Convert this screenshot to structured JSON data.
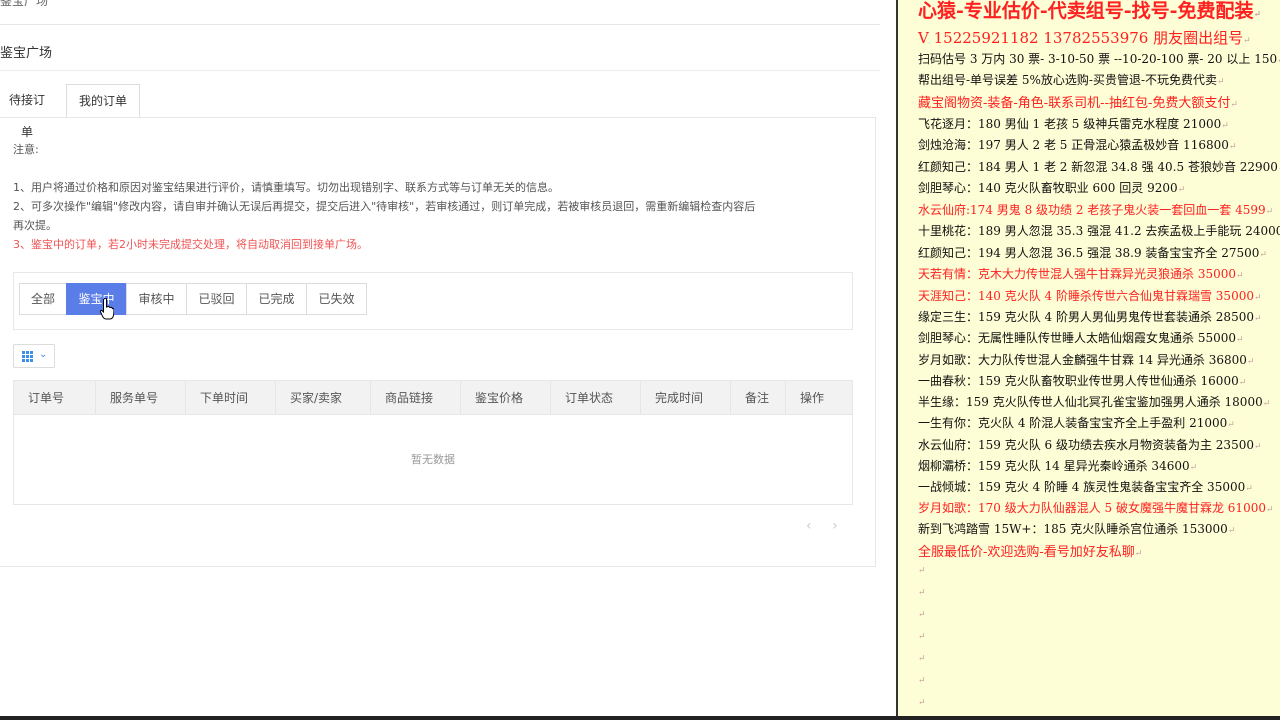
{
  "topbar": {
    "crumb": "鉴宝广场",
    "email": "",
    "logout": ""
  },
  "page_title": "鉴宝广场",
  "tabs": [
    {
      "label": "待接订单"
    },
    {
      "label": "我的订单"
    }
  ],
  "notice": {
    "heading": "注意:",
    "item1": "1、用户将通过价格和原因对鉴宝结果进行评价，请慎重填写。切勿出现错别字、联系方式等与订单无关的信息。",
    "item2a": "2、可多次操作\"编辑\"修改内容，请自审并确认无误后再提交，提交后进入\"待审核\"，若审核通过，则订单完成，若被审核员退回，需重新编辑检查内容后",
    "item2b": "再次提。",
    "item3": "3、鉴宝中的订单，若2小时未完成提交处理，将自动取消回到接单广场。"
  },
  "filters": [
    {
      "label": "全部",
      "active": false
    },
    {
      "label": "鉴宝中",
      "active": true
    },
    {
      "label": "审核中",
      "active": false
    },
    {
      "label": "已驳回",
      "active": false
    },
    {
      "label": "已完成",
      "active": false
    },
    {
      "label": "已失效",
      "active": false
    }
  ],
  "table": {
    "columns": [
      "订单号",
      "服务单号",
      "下单时间",
      "买家/卖家",
      "商品链接",
      "鉴宝价格",
      "订单状态",
      "完成时间",
      "备注",
      "操作"
    ],
    "empty_text": "暂无数据"
  },
  "icons": {
    "grid": "grid-icon",
    "chevron": "chevron-down-icon",
    "prev": "chevron-left-icon",
    "next": "chevron-right-icon",
    "cursor": "hand-cursor-icon"
  },
  "ad_lines": [
    {
      "text": "心猿-专业估价-代卖组号-找号-免费配装",
      "color": "#ff2020"
    },
    {
      "text": "V 15225921182   13782553976 朋友圈出组号",
      "color": "#ff2020"
    },
    {
      "text": "扫码估号 3 万内 30 票- 3-10-50 票  --10-20-100 票- 20 以上 150",
      "color": "#111111"
    },
    {
      "text": "帮出组号-单号误差 5%放心选购-买贵管退-不玩免费代卖",
      "color": "#111111"
    },
    {
      "text": "藏宝阁物资-装备-角色-联系司机--抽红包-免费大额支付",
      "color": "#ff2020"
    },
    {
      "text": "飞花逐月：180 男仙 1 老孩 5 级神兵雷克水程度 21000",
      "color": "#111111"
    },
    {
      "text": "剑烛沧海：197 男人 2 老 5 正骨混心猿孟极妙音 116800",
      "color": "#111111"
    },
    {
      "text": "红颜知己：184 男人 1 老 2 新忽混 34.8 强 40.5 苍狼妙音 22900",
      "color": "#111111"
    },
    {
      "text": "剑胆琴心：140 克火队畜牧职业 600 回灵 9200",
      "color": "#111111"
    },
    {
      "text": "水云仙府:174 男鬼 8 级功绩 2 老孩子鬼火装一套回血一套 4599",
      "color": "#ff2020"
    },
    {
      "text": "十里桃花：189 男人忽混 35.3 强混 41.2 去疾孟极上手能玩 24000",
      "color": "#111111"
    },
    {
      "text": "红颜知己：194 男人忽混 36.5 强混 38.9 装备宝宝齐全 27500",
      "color": "#111111"
    },
    {
      "text": "天若有情：克木大力传世混人强牛甘霖异光灵狼通杀 35000",
      "color": "#ff2020"
    },
    {
      "text": "天涯知己：140 克火队 4 阶睡杀传世六合仙鬼甘霖瑞雪 35000",
      "color": "#ff2020"
    },
    {
      "text": "缘定三生：159 克火队 4 阶男人男仙男鬼传世套装通杀 28500",
      "color": "#111111"
    },
    {
      "text": "剑胆琴心：无属性睡队传世睡人太皓仙烟霞女鬼通杀 55000",
      "color": "#111111"
    },
    {
      "text": "岁月如歌：大力队传世混人金麟强牛甘霖 14 异光通杀 36800",
      "color": "#111111"
    },
    {
      "text": "一曲春秋：159 克火队畜牧职业传世男人传世仙通杀 16000",
      "color": "#111111"
    },
    {
      "text": "半生缘：159 克火队传世人仙北冥孔雀宝鉴加强男人通杀 18000",
      "color": "#111111"
    },
    {
      "text": "一生有你：克火队 4 阶混人装备宝宝齐全上手盈利 21000",
      "color": "#111111"
    },
    {
      "text": "水云仙府：159 克火队 6 级功绩去疾水月物资装备为主 23500",
      "color": "#111111"
    },
    {
      "text": "烟柳灞桥：159 克火队 14 星异光秦岭通杀 34600",
      "color": "#111111"
    },
    {
      "text": "一战倾城：159 克火 4 阶睡 4 族灵性鬼装备宝宝齐全 35000",
      "color": "#111111"
    },
    {
      "text": "岁月如歌：170 级大力队仙器混人 5 破女魔强牛魔甘霖龙 61000",
      "color": "#ff2020"
    },
    {
      "text": "新到飞鸿踏雪 15W+：185 克火队睡杀宫位通杀 153000",
      "color": "#111111"
    },
    {
      "text": "全服最低价-欢迎选购-看号加好友私聊",
      "color": "#ff2020"
    }
  ],
  "return_mark": "↵"
}
